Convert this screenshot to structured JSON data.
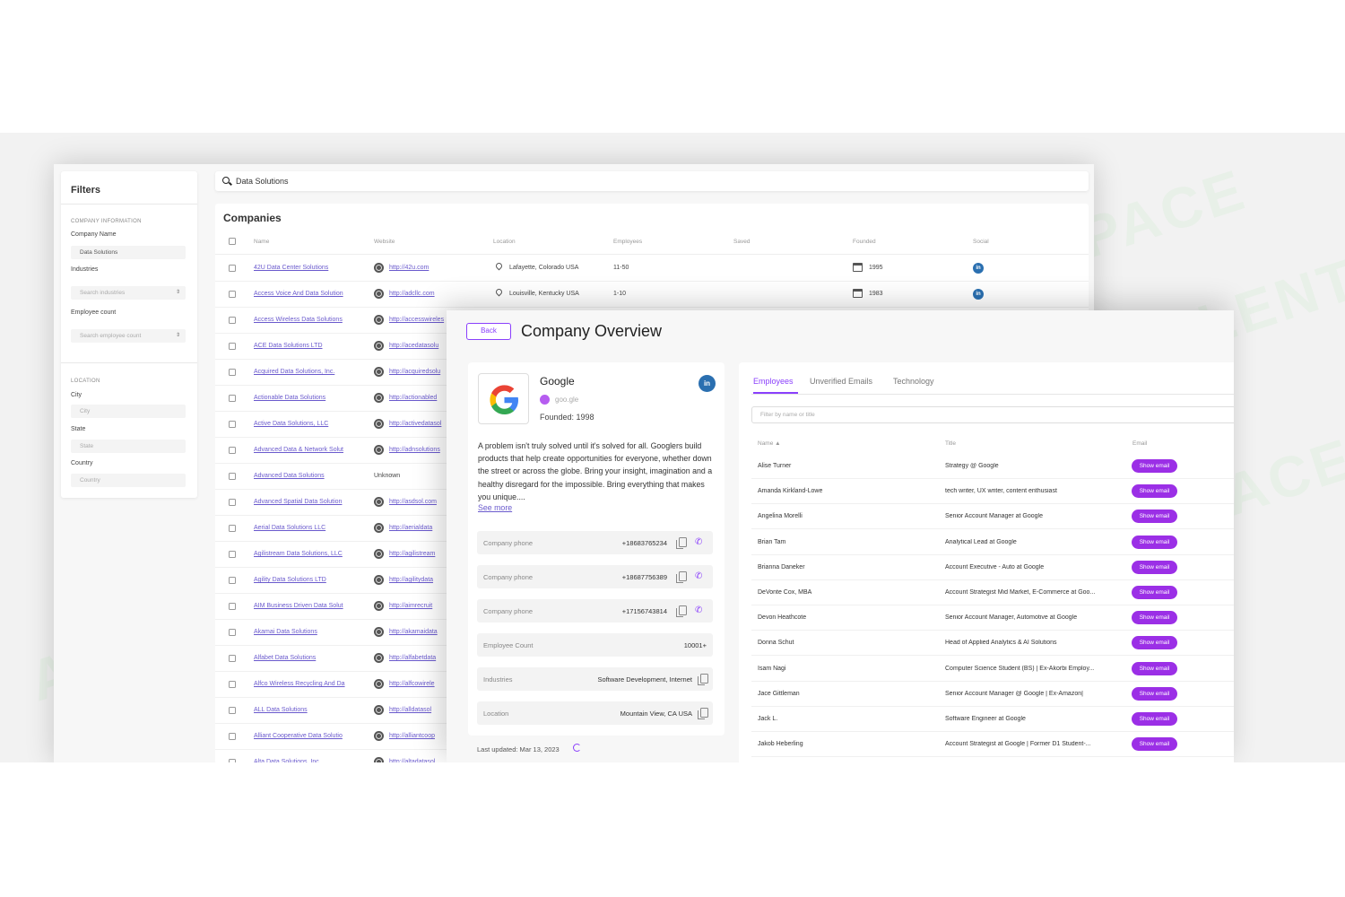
{
  "filters": {
    "title": "Filters",
    "company_section": "COMPANY INFORMATION",
    "company_name_label": "Company Name",
    "company_name_value": "Data Solutions",
    "industries_label": "Industries",
    "industries_placeholder": "Search industries",
    "employee_count_label": "Employee count",
    "employee_count_placeholder": "Search employee count",
    "location_section": "LOCATION",
    "city_label": "City",
    "city_placeholder": "City",
    "state_label": "State",
    "state_placeholder": "State",
    "country_label": "Country",
    "country_placeholder": "Country"
  },
  "search": {
    "value": "Data Solutions"
  },
  "companies": {
    "title": "Companies",
    "columns": [
      "Name",
      "Website",
      "Location",
      "Employees",
      "Saved",
      "Founded",
      "Social"
    ],
    "rows": [
      {
        "name": "42U Data Center Solutions",
        "website": "http://42u.com",
        "location": "Lafayette, Colorado USA",
        "employees": "11-50",
        "founded": "1995"
      },
      {
        "name": "Access Voice And Data Solution",
        "website": "http://adcllc.com",
        "location": "Louisville, Kentucky USA",
        "employees": "1-10",
        "founded": "1983"
      },
      {
        "name": "Access Wireless Data Solutions",
        "website": "http://accesswireles"
      },
      {
        "name": "ACE Data Solutions LTD",
        "website": "http://acedatasolu"
      },
      {
        "name": "Acquired Data Solutions, Inc.",
        "website": "http://acquiredsolu"
      },
      {
        "name": "Actionable Data Solutions",
        "website": "http://actionabled"
      },
      {
        "name": "Active Data Solutions, LLC",
        "website": "http://activedatasol"
      },
      {
        "name": "Advanced Data & Network Solut",
        "website": "http://adnsolutions"
      },
      {
        "name": "Advanced Data Solutions",
        "website": "Unknown"
      },
      {
        "name": "Advanced Spatial Data Solution",
        "website": "http://asdsol.com"
      },
      {
        "name": "Aerial Data Solutions LLC",
        "website": "http://aerialdata"
      },
      {
        "name": "Agilistream Data Solutions, LLC",
        "website": "http://agilistream"
      },
      {
        "name": "Agility Data Solutions LTD",
        "website": "http://agilitydata"
      },
      {
        "name": "AIM Business Driven Data Solut",
        "website": "http://aimrecruit"
      },
      {
        "name": "Akamai Data Solutions",
        "website": "http://akamaidata"
      },
      {
        "name": "Alfabet Data Solutions",
        "website": "http://alfabetdata"
      },
      {
        "name": "Alfco Wireless Recycling And Da",
        "website": "http://alfcowirele"
      },
      {
        "name": "ALL Data Solutions",
        "website": "http://alldatasol"
      },
      {
        "name": "Alliant Cooperative Data Solutio",
        "website": "http://alliantcoop"
      },
      {
        "name": "Alta Data Solutions, Inc.",
        "website": "http://altadatasol"
      }
    ]
  },
  "overview": {
    "back_label": "Back",
    "title": "Company Overview",
    "company_name": "Google",
    "domain": "goo.gle",
    "founded": "Founded: 1998",
    "description": "A problem isn't truly solved until it's solved for all. Googlers build products that help create opportunities for everyone, whether down the street or across the globe. Bring your insight, imagination and a healthy disregard for the impossible. Bring everything that makes you unique....",
    "see_more": "See more",
    "phone_label": "Company phone",
    "phones": [
      "+18683765234",
      "+18687756389",
      "+17156743814"
    ],
    "employee_count_label": "Employee Count",
    "employee_count_value": "10001+",
    "industries_label": "Industries",
    "industries_value": "Software Development, Internet",
    "location_label": "Location",
    "location_value": "Mountain View, CA USA",
    "last_updated": "Last updated: Mar 13, 2023",
    "linkedin": "in"
  },
  "employees_panel": {
    "tabs": [
      "Employees",
      "Unverified Emails",
      "Technology"
    ],
    "filter_placeholder": "Filter by name or title",
    "col_name": "Name ▲",
    "col_title": "Title",
    "col_email": "Email",
    "show_email": "Show email",
    "rows": [
      {
        "name": "Alise Turner",
        "title": "Strategy @ Google"
      },
      {
        "name": "Amanda Kirkland-Lowe",
        "title": "tech writer, UX writer, content enthusiast"
      },
      {
        "name": "Angelina Morelli",
        "title": "Senior Account Manager at Google"
      },
      {
        "name": "Brian Tam",
        "title": "Analytical Lead at Google"
      },
      {
        "name": "Brianna Daneker",
        "title": "Account Executive - Auto at Google"
      },
      {
        "name": "DeVonte Cox, MBA",
        "title": "Account Strategist Mid Market, E-Commerce at Goo..."
      },
      {
        "name": "Devon Heathcote",
        "title": "Senior Account Manager, Automotive at Google"
      },
      {
        "name": "Donna Schut",
        "title": "Head of Applied Analytics & AI Solutions"
      },
      {
        "name": "Isam Nagi",
        "title": "Computer Science Student (BS) | Ex-Akorbi Employ..."
      },
      {
        "name": "Jace Gittleman",
        "title": "Senior Account Manager @ Google | Ex-Amazon|"
      },
      {
        "name": "Jack L.",
        "title": "Software Engineer at Google"
      },
      {
        "name": "Jakob Heberling",
        "title": "Account Strategist at Google | Former D1 Student-..."
      }
    ]
  },
  "watermark": "AI TALENT SPACE",
  "colors": {
    "accent": "#8a3ffc",
    "link": "#6a5acd",
    "show_email": "#9b2fe6",
    "linkedin": "#2a6fb0"
  }
}
